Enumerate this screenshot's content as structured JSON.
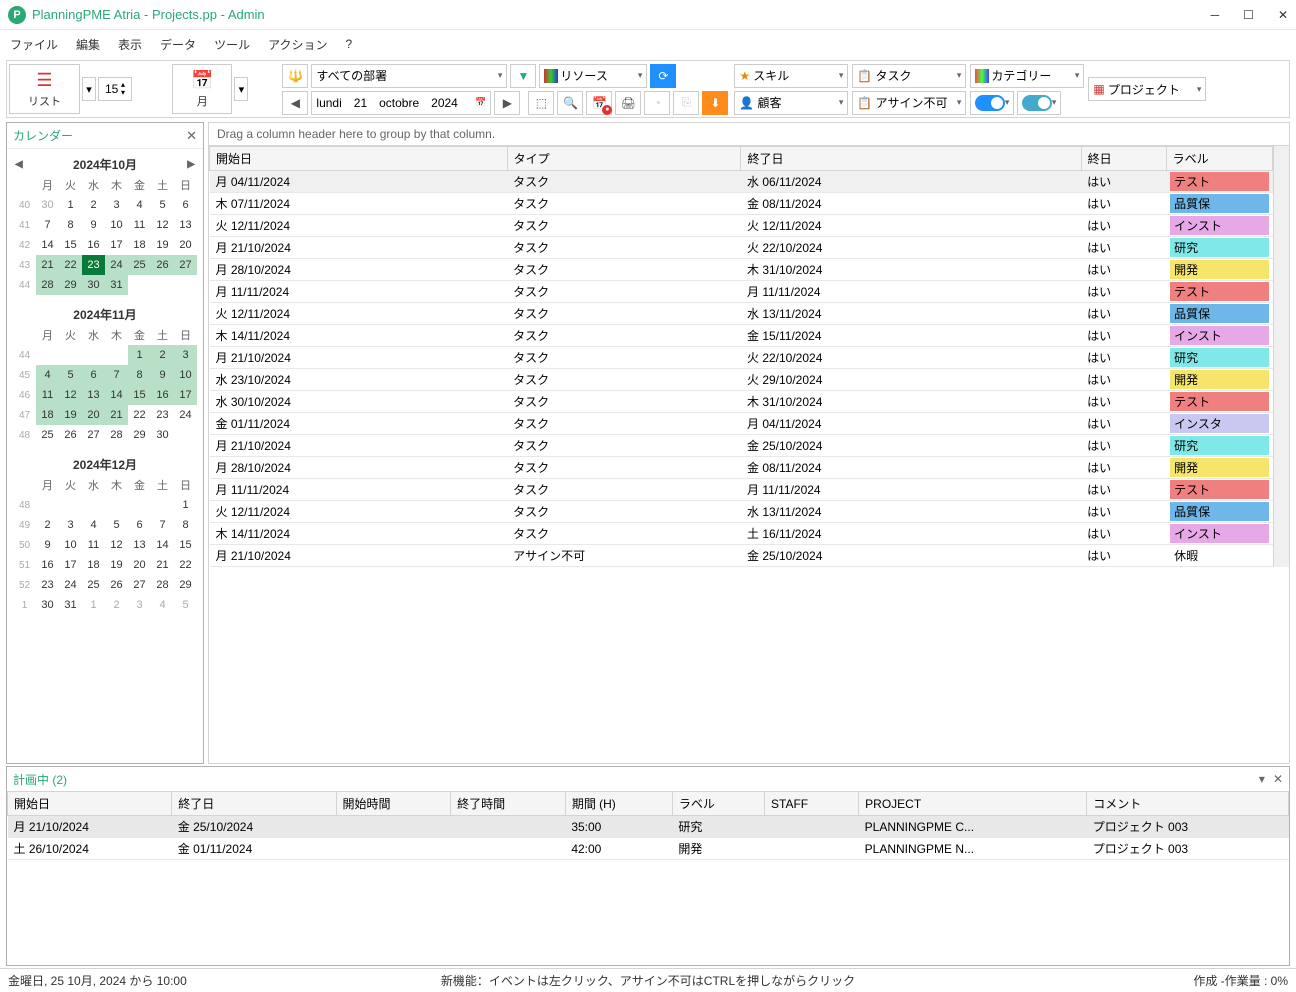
{
  "title": "PlanningPME Atria - Projects.pp - Admin",
  "menu": [
    "ファイル",
    "編集",
    "表示",
    "データ",
    "ツール",
    "アクション",
    "?"
  ],
  "toolbar": {
    "list": "リスト",
    "month": "月",
    "spin": "15",
    "date": "lundi　21　octobre　2024"
  },
  "drops": {
    "dept": "すべての部署",
    "resource": "リソース",
    "skill": "スキル",
    "task": "タスク",
    "category": "カテゴリー",
    "project": "プロジェクト",
    "customer": "顧客",
    "unassign": "アサイン不可"
  },
  "sidebar": {
    "title": "カレンダー"
  },
  "calmonths": [
    {
      "title": "2024年10月",
      "nav": true,
      "wkstart": 40,
      "prevtail": [
        30
      ],
      "days": 31,
      "hlstart": 21,
      "hlend": 31,
      "today": 23,
      "filllast": true
    },
    {
      "title": "2024年11月",
      "wkstart": 44,
      "prevtail": [],
      "leadblank": 4,
      "days": 30,
      "hlstart": 1,
      "hlend": 21,
      "prerow": [
        1,
        2,
        3
      ]
    },
    {
      "title": "2024年12月",
      "wkstart": 48,
      "prevtail": [],
      "leadblank": 6,
      "days": 31,
      "trail": [
        1,
        2,
        3,
        4,
        5
      ]
    }
  ],
  "dow": [
    "月",
    "火",
    "水",
    "木",
    "金",
    "土",
    "日"
  ],
  "gridhdr": [
    "開始日",
    "タイプ",
    "終了日",
    "終日",
    "ラベル"
  ],
  "gridhint": "Drag a column header here to group by that column.",
  "rows": [
    {
      "s": "月 04/11/2024",
      "t": "タスク",
      "e": "水 06/11/2024",
      "a": "はい",
      "l": "テスト",
      "c": "#f08080",
      "sel": true
    },
    {
      "s": "木 07/11/2024",
      "t": "タスク",
      "e": "金 08/11/2024",
      "a": "はい",
      "l": "品質保",
      "c": "#6fb7e8"
    },
    {
      "s": "火 12/11/2024",
      "t": "タスク",
      "e": "火 12/11/2024",
      "a": "はい",
      "l": "インスト",
      "c": "#e6a8e6"
    },
    {
      "s": "月 21/10/2024",
      "t": "タスク",
      "e": "火 22/10/2024",
      "a": "はい",
      "l": "研究",
      "c": "#7fe8e8"
    },
    {
      "s": "月 28/10/2024",
      "t": "タスク",
      "e": "木 31/10/2024",
      "a": "はい",
      "l": "開発",
      "c": "#f5e66b"
    },
    {
      "s": "月 11/11/2024",
      "t": "タスク",
      "e": "月 11/11/2024",
      "a": "はい",
      "l": "テスト",
      "c": "#f08080"
    },
    {
      "s": "火 12/11/2024",
      "t": "タスク",
      "e": "水 13/11/2024",
      "a": "はい",
      "l": "品質保",
      "c": "#6fb7e8"
    },
    {
      "s": "木 14/11/2024",
      "t": "タスク",
      "e": "金 15/11/2024",
      "a": "はい",
      "l": "インスト",
      "c": "#e6a8e6"
    },
    {
      "s": "月 21/10/2024",
      "t": "タスク",
      "e": "火 22/10/2024",
      "a": "はい",
      "l": "研究",
      "c": "#7fe8e8"
    },
    {
      "s": "水 23/10/2024",
      "t": "タスク",
      "e": "火 29/10/2024",
      "a": "はい",
      "l": "開発",
      "c": "#f5e66b"
    },
    {
      "s": "水 30/10/2024",
      "t": "タスク",
      "e": "木 31/10/2024",
      "a": "はい",
      "l": "テスト",
      "c": "#f08080"
    },
    {
      "s": "金 01/11/2024",
      "t": "タスク",
      "e": "月 04/11/2024",
      "a": "はい",
      "l": "インスタ",
      "c": "#c8c8f0"
    },
    {
      "s": "月 21/10/2024",
      "t": "タスク",
      "e": "金 25/10/2024",
      "a": "はい",
      "l": "研究",
      "c": "#7fe8e8"
    },
    {
      "s": "月 28/10/2024",
      "t": "タスク",
      "e": "金 08/11/2024",
      "a": "はい",
      "l": "開発",
      "c": "#f5e66b"
    },
    {
      "s": "月 11/11/2024",
      "t": "タスク",
      "e": "月 11/11/2024",
      "a": "はい",
      "l": "テスト",
      "c": "#f08080"
    },
    {
      "s": "火 12/11/2024",
      "t": "タスク",
      "e": "水 13/11/2024",
      "a": "はい",
      "l": "品質保",
      "c": "#6fb7e8"
    },
    {
      "s": "木 14/11/2024",
      "t": "タスク",
      "e": "土 16/11/2024",
      "a": "はい",
      "l": "インスト",
      "c": "#e6a8e6"
    },
    {
      "s": "月 21/10/2024",
      "t": "アサイン不可",
      "e": "金 25/10/2024",
      "a": "はい",
      "l": "休暇",
      "c": "transparent"
    }
  ],
  "bottom": {
    "title": "計画中 (2)",
    "hdr": [
      "開始日",
      "終了日",
      "開始時間",
      "終了時間",
      "期間 (H)",
      "ラベル",
      "STAFF",
      "PROJECT",
      "コメント"
    ],
    "rows": [
      {
        "s": "月 21/10/2024",
        "e": "金 25/10/2024",
        "st": "",
        "et": "",
        "d": "35:00",
        "l": "研究",
        "staff": "",
        "p": "PLANNINGPME C...",
        "c": "プロジェクト 003",
        "sel": true
      },
      {
        "s": "土 26/10/2024",
        "e": "金 01/11/2024",
        "st": "",
        "et": "",
        "d": "42:00",
        "l": "開発",
        "staff": "",
        "p": "PLANNINGPME N...",
        "c": "プロジェクト 003"
      }
    ]
  },
  "status": {
    "l": "金曜日, 25 10月, 2024 から 10:00",
    "c": "新機能：イベントは左クリック、アサイン不可はCTRLを押しながらクリック",
    "r": "作成 -作業量 : 0%"
  }
}
